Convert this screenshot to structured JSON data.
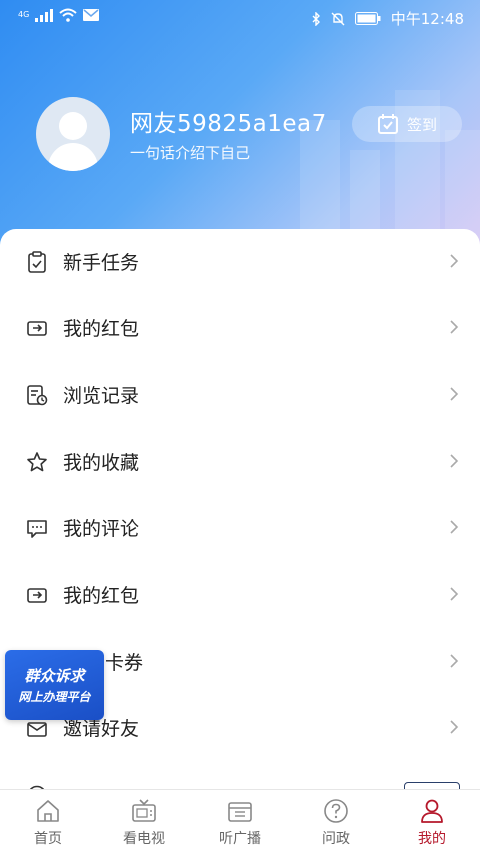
{
  "status_bar": {
    "network": "4G",
    "time": "中午12:48"
  },
  "profile": {
    "username": "网友59825a1ea7",
    "bio": "一句话介绍下自己",
    "checkin_label": "签到"
  },
  "menu": {
    "items": [
      {
        "label": "新手任务",
        "icon": "task-clipboard-icon"
      },
      {
        "label": "我的红包",
        "icon": "wallet-icon"
      },
      {
        "label": "浏览记录",
        "icon": "history-icon"
      },
      {
        "label": "我的收藏",
        "icon": "star-icon"
      },
      {
        "label": "我的评论",
        "icon": "comment-icon"
      },
      {
        "label": "我的红包",
        "icon": "wallet-icon"
      },
      {
        "label": "卡券",
        "icon": "coupon-icon"
      },
      {
        "label": "邀请好友",
        "icon": "invite-icon"
      }
    ]
  },
  "floating_banner": {
    "line1": "群众诉求",
    "line2": "网上办理平台"
  },
  "tabs": [
    {
      "label": "首页",
      "icon": "home-icon",
      "active": false
    },
    {
      "label": "看电视",
      "icon": "tv-icon",
      "active": false
    },
    {
      "label": "听广播",
      "icon": "radio-icon",
      "active": false
    },
    {
      "label": "问政",
      "icon": "question-icon",
      "active": false
    },
    {
      "label": "我的",
      "icon": "user-icon",
      "active": true
    }
  ],
  "colors": {
    "accent": "#b5182b",
    "header_blue": "#2f8cf2"
  }
}
